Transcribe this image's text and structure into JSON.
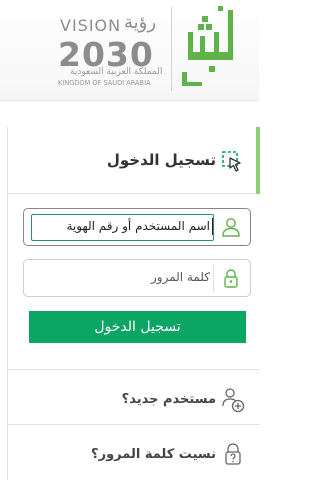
{
  "header": {
    "vision_en": "VISION",
    "vision_ar": "رؤية",
    "vision_year": "2030",
    "kingdom_ar": "المملكة العربية السعودية",
    "kingdom_en": "KINGDOM OF SAUDI ARABIA"
  },
  "login": {
    "title": "تسجيل الدخول",
    "username_value": "اسم المستخدم أو رقم الهوية",
    "password_placeholder": "كلمة المرور",
    "submit_label": "تسجيل الدخول"
  },
  "links": {
    "new_user": "مستخدم جديد؟",
    "forgot_password": "نسيت كلمة المرور؟"
  },
  "colors": {
    "brand_green": "#0ba564",
    "active_bar": "#8ccf78",
    "logo_green": "#5fb34a"
  },
  "icons": [
    "vision-2030-logo",
    "absher-logo",
    "login-cursor-icon",
    "user-icon",
    "lock-icon",
    "add-user-icon",
    "lock-question-icon"
  ]
}
